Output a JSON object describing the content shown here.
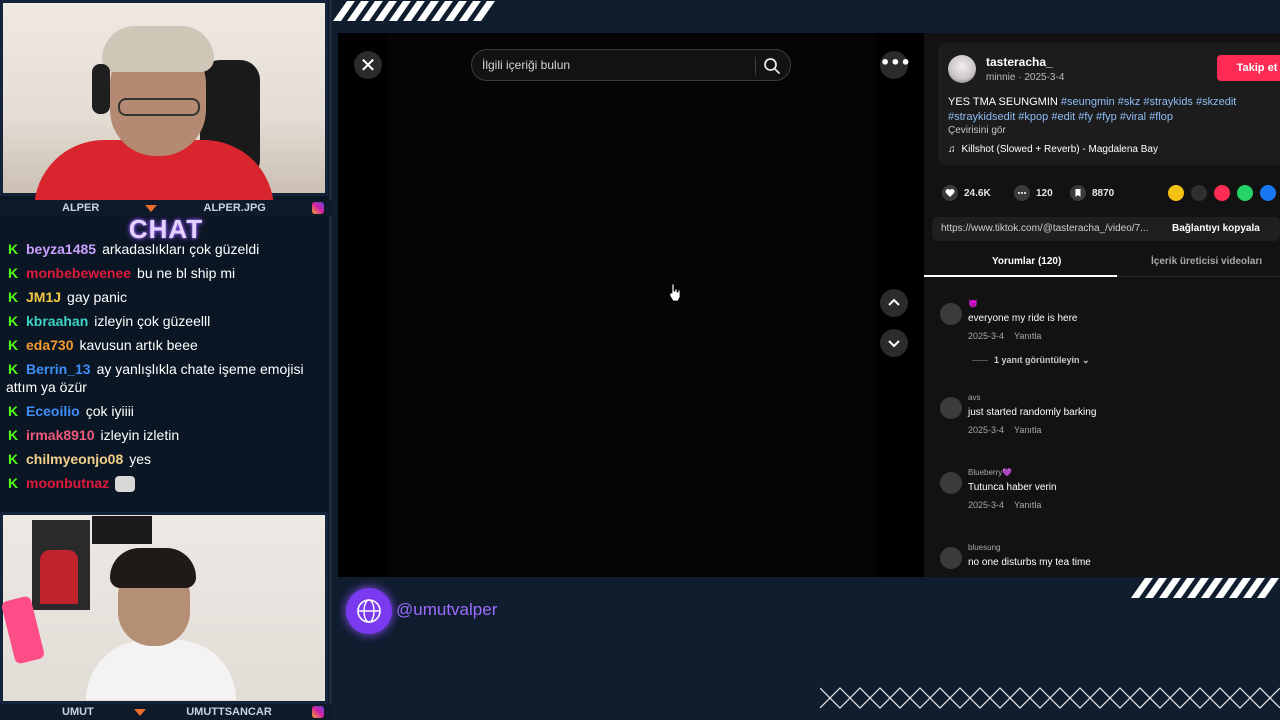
{
  "cams": {
    "top": {
      "left_label": "ALPER",
      "right_label": "ALPER.JPG"
    },
    "bottom": {
      "left_label": "UMUT",
      "right_label": "UMUTTSANCAR"
    }
  },
  "chat": {
    "title": "CHAT",
    "messages": [
      {
        "user": "beyza1485",
        "text": "arkadaslıkları çok güzeldi",
        "color": "#c9a0ff"
      },
      {
        "user": "monbebewenee",
        "text": "bu ne bl ship mi",
        "color": "#e0193b"
      },
      {
        "user": "JM1J",
        "text": "gay panic",
        "color": "#f2c744"
      },
      {
        "user": "kbraahan",
        "text": "izleyin çok güzeelll",
        "color": "#3fd3c5"
      },
      {
        "user": "eda730",
        "text": "kavusun artık beee",
        "color": "#f49b2e"
      },
      {
        "user": "Berrin_13",
        "text": "ay yanlışlıkla chate işeme emojisi attım ya özür",
        "color": "#3e8ef7"
      },
      {
        "user": "Eceoilio",
        "text": "çok iyiiii",
        "color": "#3e8ef7"
      },
      {
        "user": "irmak8910",
        "text": "izleyin izletin",
        "color": "#ee5a7e"
      },
      {
        "user": "chilmyeonjo08",
        "text": "yes",
        "color": "#f2d08a"
      },
      {
        "user": "moonbutnaz",
        "text": "",
        "color": "#e0193b"
      }
    ]
  },
  "browser": {
    "close_label": "✕",
    "search_placeholder": "İlgili içeriği bulun",
    "more_label": "•••"
  },
  "post": {
    "username": "tasteracha_",
    "submeta": "minnie · 2025-3-4",
    "follow_label": "Takip et",
    "caption_text": "YES TMA SEUNGMIN ",
    "caption_tags_1": "#seungmin #skz #straykids #skzedit",
    "caption_tags_2": "#straykidsedit #kpop #edit #fy #fyp #viral #flop",
    "translate": "Çevirisini gör",
    "music_note": "♫",
    "music": "Killshot (Slowed + Reverb) - Magdalena Bay",
    "likes": "24.6K",
    "comments_count": "120",
    "saves": "8870",
    "link": "https://www.tiktok.com/@tasteracha_/video/7...",
    "copy_label": "Bağlantıyı kopyala",
    "tab_comments": "Yorumlar (120)",
    "tab_creator": "İçerik üreticisi videoları",
    "share_colors": [
      "#f5c218",
      "#2f2f2f",
      "#fe2c55",
      "#25d366",
      "#1877f2"
    ]
  },
  "comments": [
    {
      "user": "😈",
      "text": "everyone my ride is here",
      "date": "2025-3-4",
      "reply": "Yanıtla",
      "replies": "1 yanıt görüntüleyin ⌄"
    },
    {
      "user": "avs",
      "text": "just started randomly barking",
      "date": "2025-3-4",
      "reply": "Yanıtla",
      "replies": ""
    },
    {
      "user": "Blueberry💜",
      "text": "Tutunca haber verin",
      "date": "2025-3-4",
      "reply": "Yanıtla",
      "replies": ""
    },
    {
      "user": "bluesung",
      "text": "no one disturbs my tea time",
      "date": "",
      "reply": "",
      "replies": ""
    }
  ],
  "overlay": {
    "handle": "@umutvalper"
  }
}
